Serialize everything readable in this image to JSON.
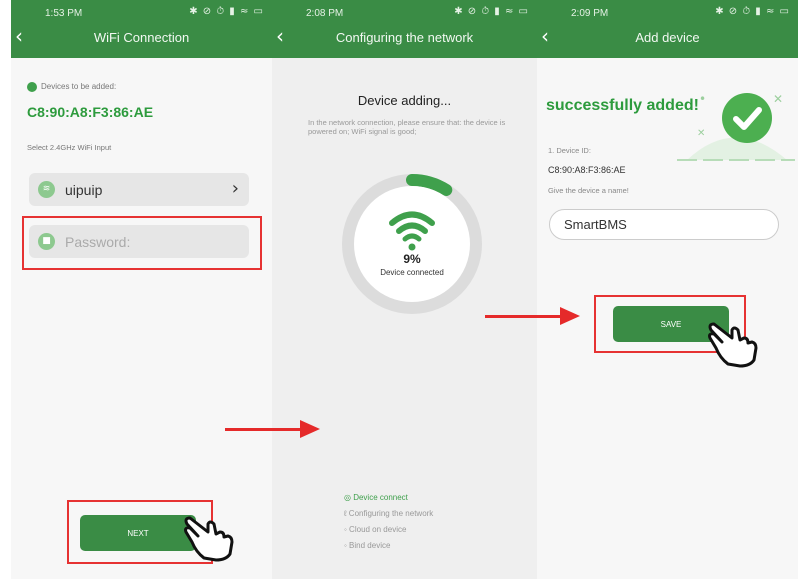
{
  "screens": [
    {
      "status_time": "1:53 PM",
      "status_icons": "✱ ⊘ ⏱ ▮ ≈ ▭",
      "back_icon": "chevron-left-icon",
      "title": "WiFi Connection",
      "devices_label": "Devices to be added:",
      "mac": "C8:90:A8:F3:86:AE",
      "select_label": "Select 2.4GHz WiFi Input",
      "wifi_name": "uipuip",
      "password_placeholder": "Password:",
      "next_label": "NEXT"
    },
    {
      "status_time": "2:08 PM",
      "status_icons": "✱ ⊘ ⏱ ▮ ≈ ▭",
      "title": "Configuring the network",
      "heading": "Device adding...",
      "note": "In the network connection, please ensure that: the device is powered on; WiFi signal is good;",
      "progress_percent": "9%",
      "progress_value": 0.09,
      "progress_label": "Device connected",
      "steps": [
        "◎ Device connect",
        "ℓ Configuring the network",
        "◦ Cloud on device",
        "◦ Bind device"
      ]
    },
    {
      "status_time": "2:09 PM",
      "status_icons": "✱ ⊘ ⏱ ▮ ≈ ▭",
      "title": "Add device",
      "success": "successfully added!",
      "device_id_label": "1. Device ID:",
      "device_id": "C8:90:A8:F3:86:AE",
      "name_prompt": "Give the device a name!",
      "name_value": "SmartBMS",
      "save_label": "SAVE"
    }
  ],
  "colors": {
    "brand_green": "#3a8c45",
    "accent_green": "#2d9b3d",
    "highlight_red": "#e63232"
  }
}
